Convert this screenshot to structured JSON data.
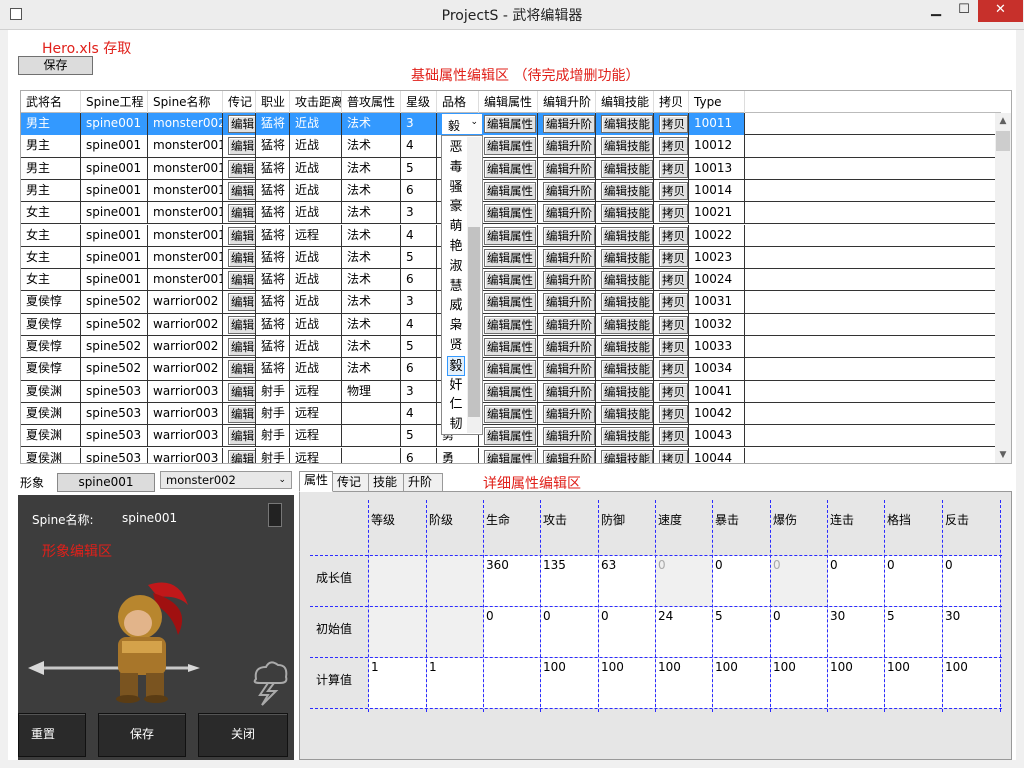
{
  "window": {
    "title": "ProjectS - 武将编辑器",
    "min_glyph": "▁",
    "max_glyph": "☐",
    "close_glyph": "✕"
  },
  "file_section": {
    "label": "Hero.xls 存取",
    "save_label": "保存"
  },
  "basic_section": {
    "label": "基础属性编辑区 （待完成增删功能）"
  },
  "table": {
    "headers": [
      "武将名",
      "Spine工程",
      "Spine名称",
      "传记",
      "职业",
      "攻击距离",
      "普攻属性",
      "星级",
      "品格",
      "编辑属性",
      "编辑升阶",
      "编辑技能",
      "拷贝",
      "Type"
    ],
    "buttons": {
      "bio": "编辑",
      "attr": "编辑属性",
      "upgrade": "编辑升阶",
      "skill": "编辑技能",
      "copy": "拷贝"
    },
    "rows": [
      {
        "name": "男主",
        "project": "spine001",
        "spine": "monster002",
        "job": "猛将",
        "range": "近战",
        "attack": "法术",
        "star": "3",
        "grade": "毅",
        "type": "10011"
      },
      {
        "name": "男主",
        "project": "spine001",
        "spine": "monster001",
        "job": "猛将",
        "range": "近战",
        "attack": "法术",
        "star": "4",
        "grade": "",
        "type": "10012"
      },
      {
        "name": "男主",
        "project": "spine001",
        "spine": "monster001",
        "job": "猛将",
        "range": "近战",
        "attack": "法术",
        "star": "5",
        "grade": "",
        "type": "10013"
      },
      {
        "name": "男主",
        "project": "spine001",
        "spine": "monster001",
        "job": "猛将",
        "range": "近战",
        "attack": "法术",
        "star": "6",
        "grade": "",
        "type": "10014"
      },
      {
        "name": "女主",
        "project": "spine001",
        "spine": "monster001",
        "job": "猛将",
        "range": "近战",
        "attack": "法术",
        "star": "3",
        "grade": "",
        "type": "10021"
      },
      {
        "name": "女主",
        "project": "spine001",
        "spine": "monster001",
        "job": "猛将",
        "range": "远程",
        "attack": "法术",
        "star": "4",
        "grade": "",
        "type": "10022"
      },
      {
        "name": "女主",
        "project": "spine001",
        "spine": "monster001",
        "job": "猛将",
        "range": "近战",
        "attack": "法术",
        "star": "5",
        "grade": "",
        "type": "10023"
      },
      {
        "name": "女主",
        "project": "spine001",
        "spine": "monster001",
        "job": "猛将",
        "range": "近战",
        "attack": "法术",
        "star": "6",
        "grade": "",
        "type": "10024"
      },
      {
        "name": "夏侯惇",
        "project": "spine502",
        "spine": "warrior002",
        "job": "猛将",
        "range": "近战",
        "attack": "法术",
        "star": "3",
        "grade": "",
        "type": "10031"
      },
      {
        "name": "夏侯惇",
        "project": "spine502",
        "spine": "warrior002",
        "job": "猛将",
        "range": "近战",
        "attack": "法术",
        "star": "4",
        "grade": "",
        "type": "10032"
      },
      {
        "name": "夏侯惇",
        "project": "spine502",
        "spine": "warrior002",
        "job": "猛将",
        "range": "近战",
        "attack": "法术",
        "star": "5",
        "grade": "",
        "type": "10033"
      },
      {
        "name": "夏侯惇",
        "project": "spine502",
        "spine": "warrior002",
        "job": "猛将",
        "range": "近战",
        "attack": "法术",
        "star": "6",
        "grade": "",
        "type": "10034"
      },
      {
        "name": "夏侯渊",
        "project": "spine503",
        "spine": "warrior003",
        "job": "射手",
        "range": "远程",
        "attack": "物理",
        "star": "3",
        "grade": "",
        "type": "10041"
      },
      {
        "name": "夏侯渊",
        "project": "spine503",
        "spine": "warrior003",
        "job": "射手",
        "range": "远程",
        "attack": "",
        "star": "4",
        "grade": "",
        "type": "10042"
      },
      {
        "name": "夏侯渊",
        "project": "spine503",
        "spine": "warrior003",
        "job": "射手",
        "range": "远程",
        "attack": "",
        "star": "5",
        "grade": "勇",
        "type": "10043"
      },
      {
        "name": "夏侯渊",
        "project": "spine503",
        "spine": "warrior003",
        "job": "射手",
        "range": "远程",
        "attack": "",
        "star": "6",
        "grade": "勇",
        "type": "10044"
      }
    ]
  },
  "grade_dropdown": {
    "selected": "毅",
    "options": [
      "恶",
      "毒",
      "骚",
      "豪",
      "萌",
      "艳",
      "淑",
      "慧",
      "威",
      "枭",
      "贤",
      "毅",
      "奸",
      "仁",
      "韧"
    ]
  },
  "image_section": {
    "label": "形象",
    "spine_project": "spine001",
    "spine_name_select": "monster002",
    "preview_name_label": "Spine名称:",
    "preview_name_value": "spine001",
    "area_label": "形象编辑区",
    "reset_label": "重置",
    "save_label": "保存",
    "close_label": "关闭"
  },
  "detail": {
    "tabs": [
      "属性",
      "传记",
      "技能",
      "升阶"
    ],
    "label": "详细属性编辑区",
    "columns": [
      "等级",
      "阶级",
      "生命",
      "攻击",
      "防御",
      "速度",
      "暴击",
      "爆伤",
      "连击",
      "格挡",
      "反击"
    ],
    "rows": [
      {
        "label": "成长值",
        "values": [
          "",
          "",
          "360",
          "135",
          "63",
          "0",
          "0",
          "0",
          "0",
          "0",
          "0"
        ]
      },
      {
        "label": "初始值",
        "values": [
          "",
          "",
          "0",
          "0",
          "0",
          "24",
          "5",
          "0",
          "30",
          "5",
          "30"
        ]
      },
      {
        "label": "计算值",
        "values": [
          "1",
          "1",
          "",
          "100",
          "100",
          "100",
          "100",
          "100",
          "100",
          "100",
          "100"
        ]
      }
    ]
  }
}
